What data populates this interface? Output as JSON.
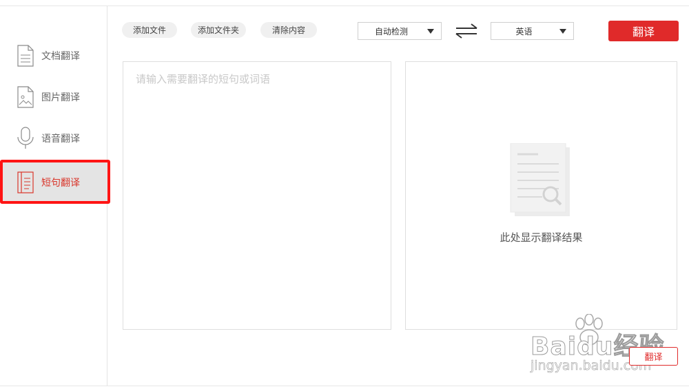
{
  "sidebar": {
    "items": [
      {
        "label": "文档翻译",
        "icon": "document-icon"
      },
      {
        "label": "图片翻译",
        "icon": "image-icon"
      },
      {
        "label": "语音翻译",
        "icon": "microphone-icon"
      },
      {
        "label": "短句翻译",
        "icon": "text-lines-icon",
        "active": true
      }
    ]
  },
  "toolbar": {
    "add_file": "添加文件",
    "add_folder": "添加文件夹",
    "clear_content": "清除内容",
    "source_lang": "自动检测",
    "swap_icon": "swap-arrows-icon",
    "target_lang": "英语",
    "translate_label": "翻译"
  },
  "input": {
    "placeholder": "请输入需要翻译的短句或词语",
    "value": ""
  },
  "result": {
    "placeholder_text": "此处显示翻译结果",
    "illustration": "document-search-icon"
  },
  "footer": {
    "translate_label": "翻译"
  },
  "watermark": {
    "text": "Baidu经验",
    "url": "jingyan.baidu.com"
  },
  "colors": {
    "accent": "#e02a2a",
    "highlight_border": "#ff1414",
    "active_bg": "#e4e4e4"
  }
}
